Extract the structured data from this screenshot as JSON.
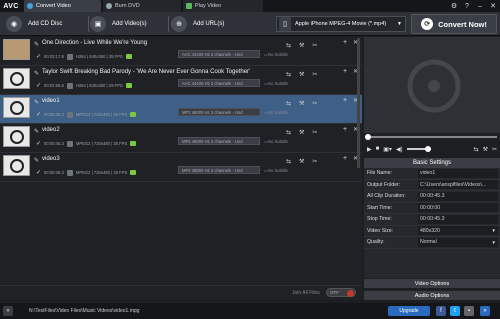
{
  "app": {
    "logo": "AVC"
  },
  "tabs": [
    {
      "label": "Convert Video"
    },
    {
      "label": "Burn DVD"
    },
    {
      "label": "Play Video"
    }
  ],
  "window_controls": {
    "settings": "⚙",
    "help": "?",
    "minimize": "–",
    "close": "✕"
  },
  "toolbar": {
    "add_cd": "Add CD Disc",
    "add_videos": "Add Video(s)",
    "add_urls": "Add URL(s)",
    "profile": "Apple iPhone MPEG-4 Movie (*.mp4)",
    "convert": "Convert Now!"
  },
  "files": [
    {
      "title": "One Direction - Live While We're Young",
      "duration": "00:03:17.8",
      "codec": "H264 | 640x360 | 25 FPS",
      "audio": "AAC 44100 Hz 2 channels - Und",
      "subtitle": "No Subtitle",
      "thumb": "image"
    },
    {
      "title": "Taylor Swift  Breaking Bad Parody - 'We Are Never Ever Gonna Cook Together'",
      "duration": "00:02:56.8",
      "codec": "H264 | 640x360 | 29 FPS",
      "audio": "AAC 44100 Hz 2 channels - Und",
      "subtitle": "No Subtitle",
      "thumb": "film"
    },
    {
      "title": "video1",
      "duration": "00:00:45.3",
      "codec": "MPEG2 | 720x480 | 30 FPS",
      "audio": "MP2 48000 Hz 2 channels - Und",
      "subtitle": "No Subtitle",
      "thumb": "film"
    },
    {
      "title": "video2",
      "duration": "00:00:45.3",
      "codec": "MPEG2 | 720x480 | 30 FPS",
      "audio": "MP2 48000 Hz 2 channels - Und",
      "subtitle": "No Subtitle",
      "thumb": "film"
    },
    {
      "title": "video3",
      "duration": "00:00:45.3",
      "codec": "MPEG2 | 720x480 | 30 FPS",
      "audio": "MP2 48000 Hz 2 channels - Und",
      "subtitle": "No Subtitle",
      "thumb": "film"
    }
  ],
  "join": {
    "label": "Join All Files",
    "state": "OFF"
  },
  "settings": {
    "header": "Basic Settings",
    "rows": [
      {
        "key": "File Name:",
        "value": "video1"
      },
      {
        "key": "Output Folder:",
        "value": "C:\\Users\\ansplfiles\\Videos\\..."
      },
      {
        "key": "All Clip Duration:",
        "value": "00:00:45.3"
      },
      {
        "key": "Start Time:",
        "value": "00:00:00"
      },
      {
        "key": "Stop Time:",
        "value": "00:00:45.3"
      },
      {
        "key": "Video Size:",
        "value": "480x320"
      },
      {
        "key": "Quality:",
        "value": "Normal"
      }
    ],
    "video_options": "Video Options",
    "audio_options": "Audio Options"
  },
  "status": {
    "path": "N:\\TestFiles\\Video Files\\Music Videos\\video1.mpg",
    "upgrade": "Upgrade"
  },
  "colors": {
    "accent": "#3e5f86",
    "convert_bg": "#3a3f47",
    "toggle_off": "#c0392b"
  }
}
